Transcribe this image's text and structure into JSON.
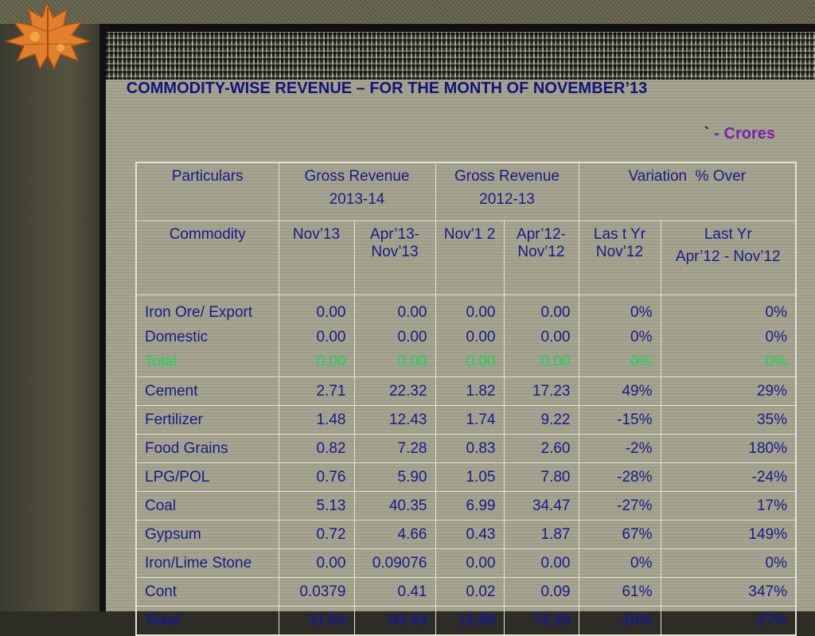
{
  "title": "COMMODITY-WISE REVENUE – FOR THE MONTH OF NOVEMBER’13",
  "units": {
    "symbol": "`",
    "label": "- Crores"
  },
  "header": {
    "particulars": "Particulars",
    "gross_2013_line1": "Gross Revenue",
    "gross_2013_line2": "2013-14",
    "gross_2012_line1": "Gross Revenue",
    "gross_2012_line2": "2012-13",
    "variation": "Variation  % Over"
  },
  "subheader": {
    "commodity": "Commodity",
    "nov13": "Nov’13",
    "apr13": "Apr’13-Nov’13",
    "nov12": "Nov’1 2",
    "apr12": "Apr’12-Nov’12",
    "last_yr_nov": "Las t Yr Nov’12",
    "last_yr_apr_line1": "Last Yr",
    "last_yr_apr_line2": "Apr’12 - Nov’12"
  },
  "iron": {
    "labels": [
      "Iron Ore/ Export",
      "Domestic",
      "Total"
    ],
    "nov13": [
      "0.00",
      "0.00",
      "0.00"
    ],
    "apr13": [
      "0.00",
      "0.00",
      "0.00"
    ],
    "nov12": [
      "0.00",
      "0.00",
      "0.00"
    ],
    "apr12": [
      "0.00",
      "0.00",
      "0.00"
    ],
    "var_nov": [
      "0%",
      "0%",
      "0%"
    ],
    "var_apr": [
      "0%",
      "0%",
      "0%"
    ]
  },
  "rows": [
    {
      "name": "Cement",
      "nov13": "2.71",
      "apr13": "22.32",
      "nov12": "1.82",
      "apr12": "17.23",
      "var_nov": "49%",
      "var_apr": "29%"
    },
    {
      "name": "Fertilizer",
      "nov13": "1.48",
      "apr13": "12.43",
      "nov12": "1.74",
      "apr12": "9.22",
      "var_nov": "-15%",
      "var_apr": "35%"
    },
    {
      "name": "Food Grains",
      "nov13": "0.82",
      "apr13": "7.28",
      "nov12": "0.83",
      "apr12": "2.60",
      "var_nov": "-2%",
      "var_apr": "180%"
    },
    {
      "name": "LPG/POL",
      "nov13": "0.76",
      "apr13": "5.90",
      "nov12": "1.05",
      "apr12": "7.80",
      "var_nov": "-28%",
      "var_apr": "-24%"
    },
    {
      "name": "Coal",
      "nov13": "5.13",
      "apr13": "40.35",
      "nov12": "6.99",
      "apr12": "34.47",
      "var_nov": "-27%",
      "var_apr": "17%"
    },
    {
      "name": "Gypsum",
      "nov13": "0.72",
      "apr13": "4.66",
      "nov12": "0.43",
      "apr12": "1.87",
      "var_nov": "67%",
      "var_apr": "149%"
    },
    {
      "name": "Iron/Lime Stone",
      "nov13": "0.00",
      "apr13": "0.09076",
      "nov12": "0.00",
      "apr12": "0.00",
      "var_nov": "0%",
      "var_apr": "0%"
    },
    {
      "name": "Cont",
      "nov13": "0.0379",
      "apr13": "0.41",
      "nov12": "0.02",
      "apr12": "0.09",
      "var_nov": "61%",
      "var_apr": "347%"
    }
  ],
  "total": {
    "name": "Total",
    "nov13": "11.64",
    "apr13": "93.43",
    "nov12": "12.88",
    "apr12": "73.29",
    "var_nov": "-10%",
    "var_apr": "27%"
  },
  "colors": {
    "text": "#1a1a8c",
    "title": "#13137a",
    "units": "#7b1fb0",
    "total_green": "#1ed35a"
  },
  "icons": {
    "leaf": "autumn-leaf-icon"
  }
}
